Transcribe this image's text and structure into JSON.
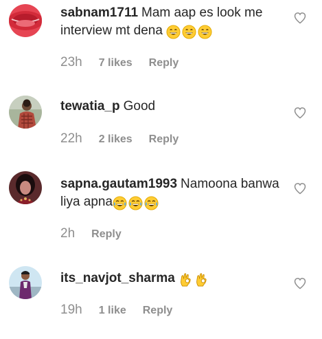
{
  "reply_label": "Reply",
  "comments": [
    {
      "username": "sabnam1711",
      "text": "Mam aap es look me interview mt dena",
      "emojis": [
        "grinning-face",
        "grinning-face",
        "grinning-face"
      ],
      "time": "23h",
      "likes": "7 likes"
    },
    {
      "username": "tewatia_p",
      "text": "Good",
      "emojis": [],
      "time": "22h",
      "likes": "2 likes"
    },
    {
      "username": "sapna.gautam1993",
      "text": "Namoona banwa liya apna",
      "emojis": [
        "tears-of-joy-face",
        "tears-of-joy-face",
        "tears-of-joy-face"
      ],
      "time": "2h",
      "likes": ""
    },
    {
      "username": "its_navjot_sharma",
      "text": "",
      "emojis": [
        "ok-hand",
        "ok-hand"
      ],
      "time": "19h",
      "likes": "1 like"
    }
  ],
  "colors": {
    "text": "#262626",
    "meta": "#8e8e8e",
    "heart_outline": "#8e8e8e"
  }
}
